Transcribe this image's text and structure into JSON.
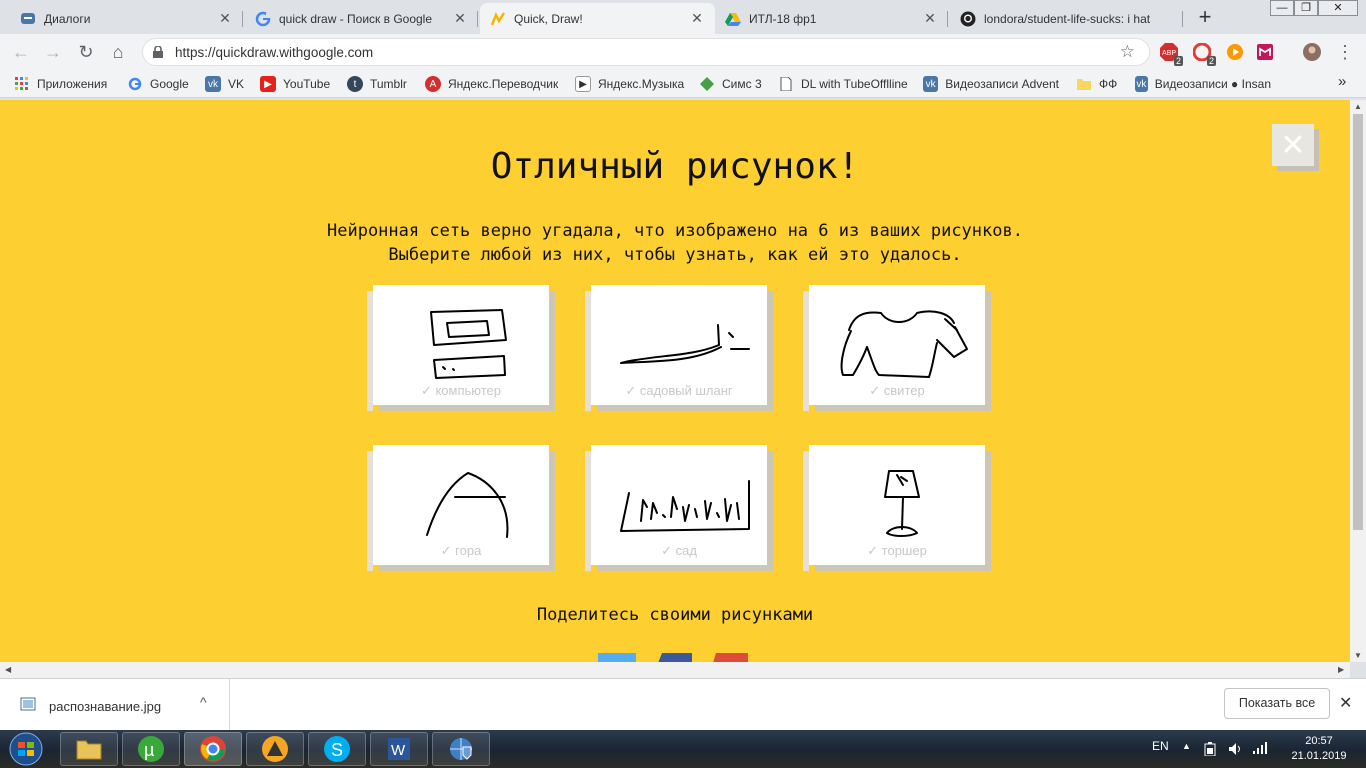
{
  "tabs": [
    {
      "title": "Диалоги",
      "icon": "vk-dialogs-icon",
      "active": false
    },
    {
      "title": "quick draw - Поиск в Google",
      "icon": "google-icon",
      "active": false
    },
    {
      "title": "Quick, Draw!",
      "icon": "quickdraw-icon",
      "active": true
    },
    {
      "title": "ИТЛ-18 фр1",
      "icon": "google-drive-icon",
      "active": false
    },
    {
      "title": "londora/student-life-sucks: i hat",
      "icon": "github-icon",
      "active": false
    }
  ],
  "tab_close_glyph": "✕",
  "new_tab_glyph": "+",
  "window_controls": {
    "minimize": "—",
    "maximize": "❐",
    "close": "✕"
  },
  "toolbar": {
    "back_glyph": "←",
    "forward_glyph": "→",
    "reload_glyph": "↻",
    "home_glyph": "⌂",
    "url": "https://quickdraw.withgoogle.com",
    "star_glyph": "☆",
    "menu_glyph": "⋮",
    "extension_badges": [
      "2",
      "2"
    ]
  },
  "bookmarks": [
    {
      "label": "Приложения",
      "icon": "apps-grid-icon"
    },
    {
      "label": "Google",
      "icon": "google-icon"
    },
    {
      "label": "VK",
      "icon": "vk-icon"
    },
    {
      "label": "YouTube",
      "icon": "youtube-icon"
    },
    {
      "label": "Tumblr",
      "icon": "tumblr-icon"
    },
    {
      "label": "Яндекс.Переводчик",
      "icon": "yandex-translate-icon"
    },
    {
      "label": "Яндекс.Музыка",
      "icon": "yandex-music-icon"
    },
    {
      "label": "Симс 3",
      "icon": "sims-icon"
    },
    {
      "label": "DL with TubeOfflline",
      "icon": "document-icon"
    },
    {
      "label": "Видеозаписи Advent",
      "icon": "vk-icon"
    },
    {
      "label": "ФФ",
      "icon": "folder-icon"
    },
    {
      "label": "Видеозаписи ● Insan",
      "icon": "vk-icon"
    }
  ],
  "bookmarks_more_glyph": "»",
  "page": {
    "close_glyph": "✕",
    "headline": "Отличный рисунок!",
    "subtext_line1": "Нейронная сеть верно угадала, что изображено на 6 из ваших рисунков.",
    "subtext_line2": "Выберите любой из них, чтобы узнать, как ей это удалось.",
    "drawings": [
      {
        "label": "✓ компьютер",
        "subject": "computer"
      },
      {
        "label": "✓ садовый шланг",
        "subject": "garden-hose"
      },
      {
        "label": "✓ свитер",
        "subject": "sweater"
      },
      {
        "label": "✓ гора",
        "subject": "mountain"
      },
      {
        "label": "✓ сад",
        "subject": "garden"
      },
      {
        "label": "✓ торшер",
        "subject": "floor-lamp"
      }
    ],
    "share_title": "Поделитесь своими рисунками",
    "share_colors": [
      "#55acee",
      "#3b5998",
      "#dd4b39"
    ]
  },
  "download_shelf": {
    "filename": "распознавание.jpg",
    "caret_glyph": "^",
    "show_all": "Показать все",
    "close_glyph": "✕"
  },
  "taskbar": {
    "language": "EN",
    "time": "20:57",
    "date": "21.01.2019"
  }
}
